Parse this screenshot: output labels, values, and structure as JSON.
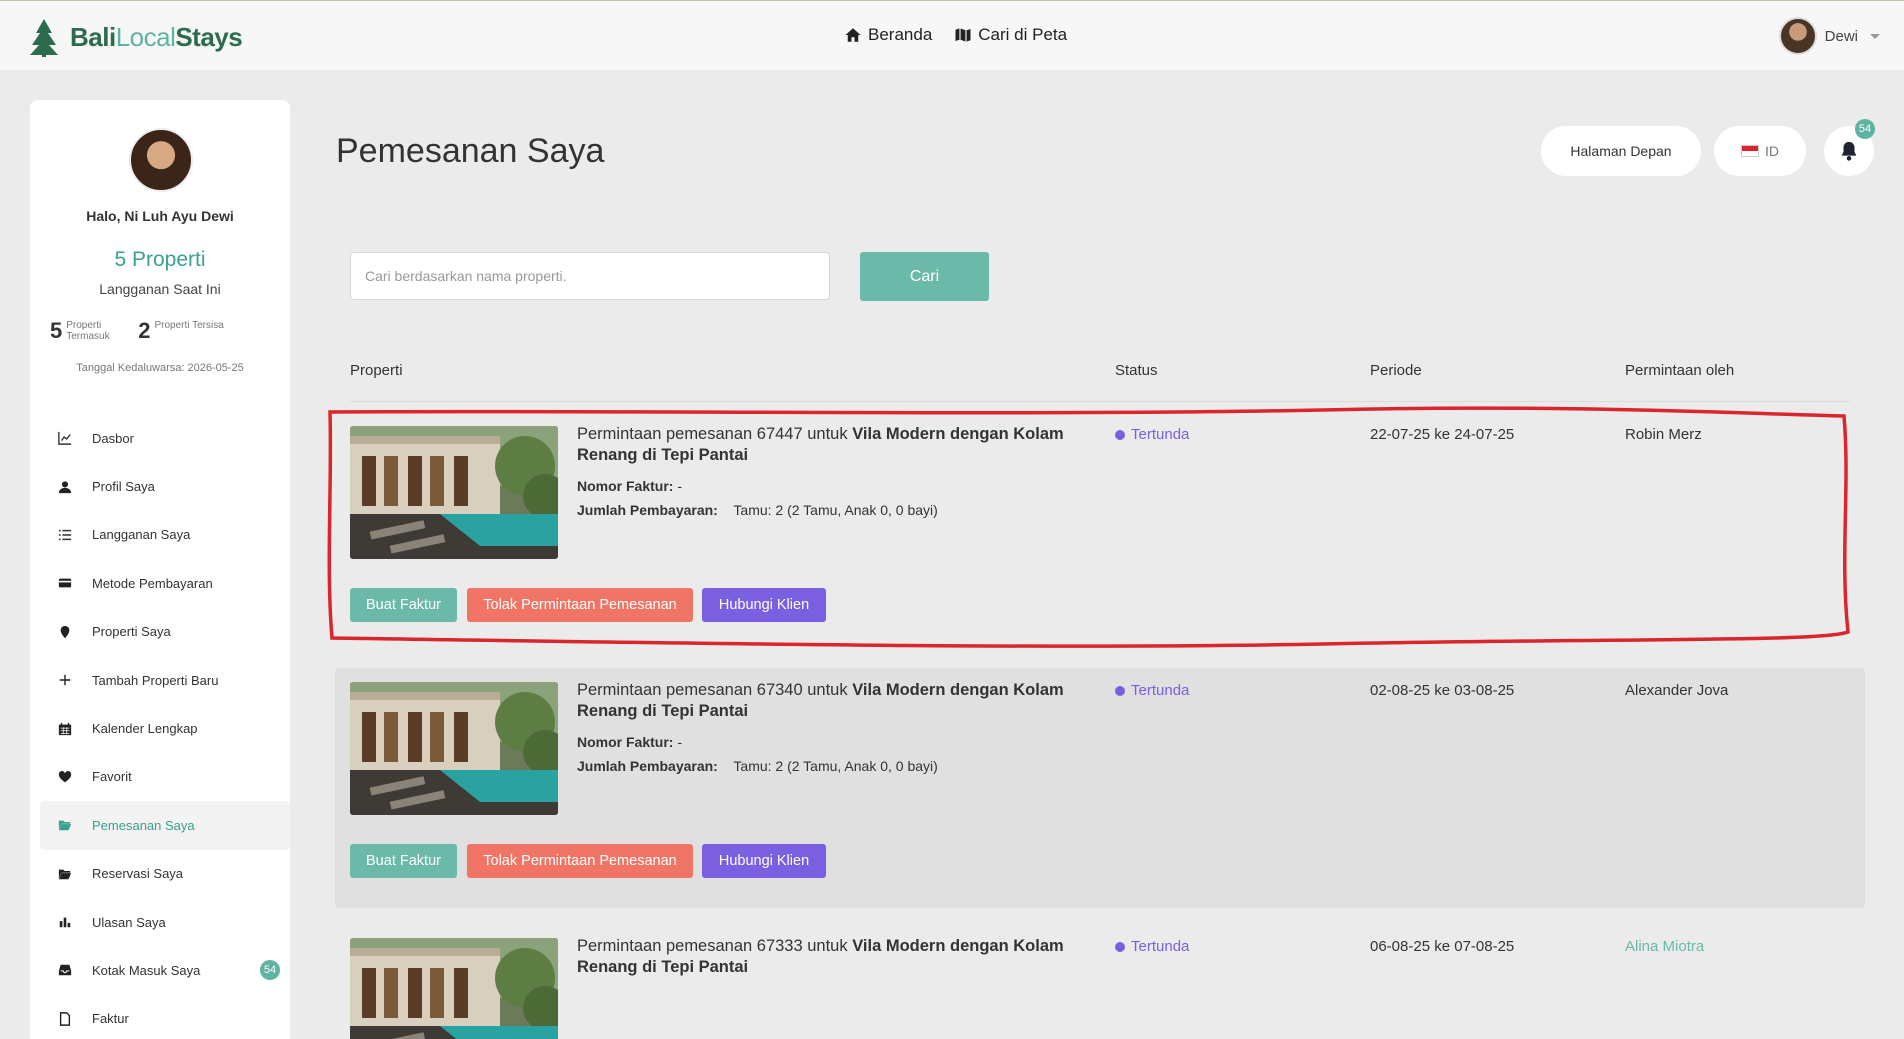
{
  "brand": {
    "part1": "Bali",
    "part2": "Local",
    "part3": "Stays"
  },
  "topnav": {
    "home_label": "Beranda",
    "map_label": "Cari di Peta"
  },
  "user": {
    "name": "Dewi"
  },
  "sidebar": {
    "greeting": "Halo, Ni Luh Ayu Dewi",
    "plan_count": "5 Properti",
    "plan_sub": "Langganan Saat Ini",
    "included_num": "5",
    "included_label": "Properti Termasuk",
    "remaining_num": "2",
    "remaining_label": "Properti Tersisa",
    "expiry": "Tanggal Kedaluwarsa: 2026-05-25",
    "items": [
      {
        "label": "Dasbor",
        "icon": "chart-icon"
      },
      {
        "label": "Profil Saya",
        "icon": "user-icon"
      },
      {
        "label": "Langganan Saya",
        "icon": "list-icon"
      },
      {
        "label": "Metode Pembayaran",
        "icon": "card-icon"
      },
      {
        "label": "Properti Saya",
        "icon": "pin-icon"
      },
      {
        "label": "Tambah Properti Baru",
        "icon": "plus-icon"
      },
      {
        "label": "Kalender Lengkap",
        "icon": "calendar-icon"
      },
      {
        "label": "Favorit",
        "icon": "heart-icon"
      },
      {
        "label": "Pemesanan Saya",
        "icon": "folder-open-icon"
      },
      {
        "label": "Reservasi Saya",
        "icon": "folder-open-icon"
      },
      {
        "label": "Ulasan Saya",
        "icon": "bar-chart-icon"
      },
      {
        "label": "Kotak Masuk Saya",
        "icon": "inbox-icon",
        "badge": "54"
      },
      {
        "label": "Faktur",
        "icon": "file-icon"
      }
    ]
  },
  "main": {
    "title": "Pemesanan Saya",
    "home_button": "Halaman Depan",
    "lang": "ID",
    "bell_count": "54",
    "search_placeholder": "Cari berdasarkan nama properti.",
    "search_button": "Cari",
    "columns": {
      "property": "Properti",
      "status": "Status",
      "period": "Periode",
      "requested_by": "Permintaan oleh"
    },
    "rows": [
      {
        "request_prefix": "Permintaan pemesanan 67447 untuk ",
        "property": "Vila Modern dengan Kolam Renang di Tepi Pantai",
        "invoice_label": "Nomor Faktur:",
        "invoice_value": "-",
        "payment_label": "Jumlah Pembayaran:",
        "guests": "Tamu: 2 (2 Tamu, Anak 0, 0 bayi)",
        "status": "Tertunda",
        "period": "22-07-25 ke 24-07-25",
        "requested_by": "Robin Merz",
        "btn_invoice": "Buat Faktur",
        "btn_reject": "Tolak Permintaan Pemesanan",
        "btn_contact": "Hubungi Klien"
      },
      {
        "request_prefix": "Permintaan pemesanan 67340 untuk ",
        "property": "Vila Modern dengan Kolam Renang di Tepi Pantai",
        "invoice_label": "Nomor Faktur:",
        "invoice_value": "-",
        "payment_label": "Jumlah Pembayaran:",
        "guests": "Tamu: 2 (2 Tamu, Anak 0, 0 bayi)",
        "status": "Tertunda",
        "period": "02-08-25 ke 03-08-25",
        "requested_by": "Alexander Jova",
        "btn_invoice": "Buat Faktur",
        "btn_reject": "Tolak Permintaan Pemesanan",
        "btn_contact": "Hubungi Klien"
      },
      {
        "request_prefix": "Permintaan pemesanan 67333 untuk ",
        "property": "Vila Modern dengan Kolam Renang di Tepi Pantai",
        "status": "Tertunda",
        "period": "06-08-25 ke 07-08-25",
        "requested_by": "Alina Miotra"
      }
    ]
  },
  "colors": {
    "accent": "#6bbaa9",
    "danger": "#f07566",
    "purple": "#7a5fe0",
    "annotation": "#d9252b"
  }
}
